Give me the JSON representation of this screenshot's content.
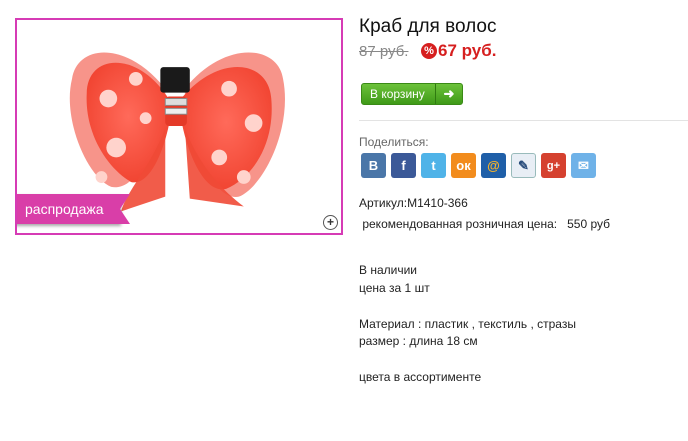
{
  "product": {
    "title": "Краб для волос",
    "old_price": "87 руб.",
    "discount_icon": "%",
    "new_price": "67 руб.",
    "sale_badge": "распродажа",
    "zoom_icon": "+",
    "image_icon": "bow-hair-clip-image"
  },
  "cart": {
    "button_label": "В корзину",
    "arrow": "➜"
  },
  "share": {
    "label": "Поделиться:",
    "buttons": [
      {
        "name": "vkontakte",
        "glyph": "B"
      },
      {
        "name": "facebook",
        "glyph": "f"
      },
      {
        "name": "twitter",
        "glyph": "t"
      },
      {
        "name": "odnoklassniki",
        "glyph": "ок"
      },
      {
        "name": "mail-ru",
        "glyph": "@"
      },
      {
        "name": "livejournal",
        "glyph": "✎"
      },
      {
        "name": "google-plus",
        "glyph": "g+"
      },
      {
        "name": "email",
        "glyph": "✉"
      }
    ]
  },
  "details": {
    "article": "Артикул:М1410-366",
    "recommended_price": " рекомендованная розничная цена:   550 руб",
    "availability": "В наличии",
    "unit_price": "цена за 1 шт",
    "material": "Материал : пластик , текстиль , стразы",
    "size": "размер : длина 18 см",
    "colors": "цвета в ассортименте"
  },
  "colors": {
    "frame_border": "#d63bb5",
    "sale_ribbon": "#d93ea8",
    "price_red": "#d61f1f",
    "cart_green": "#4ca823"
  }
}
